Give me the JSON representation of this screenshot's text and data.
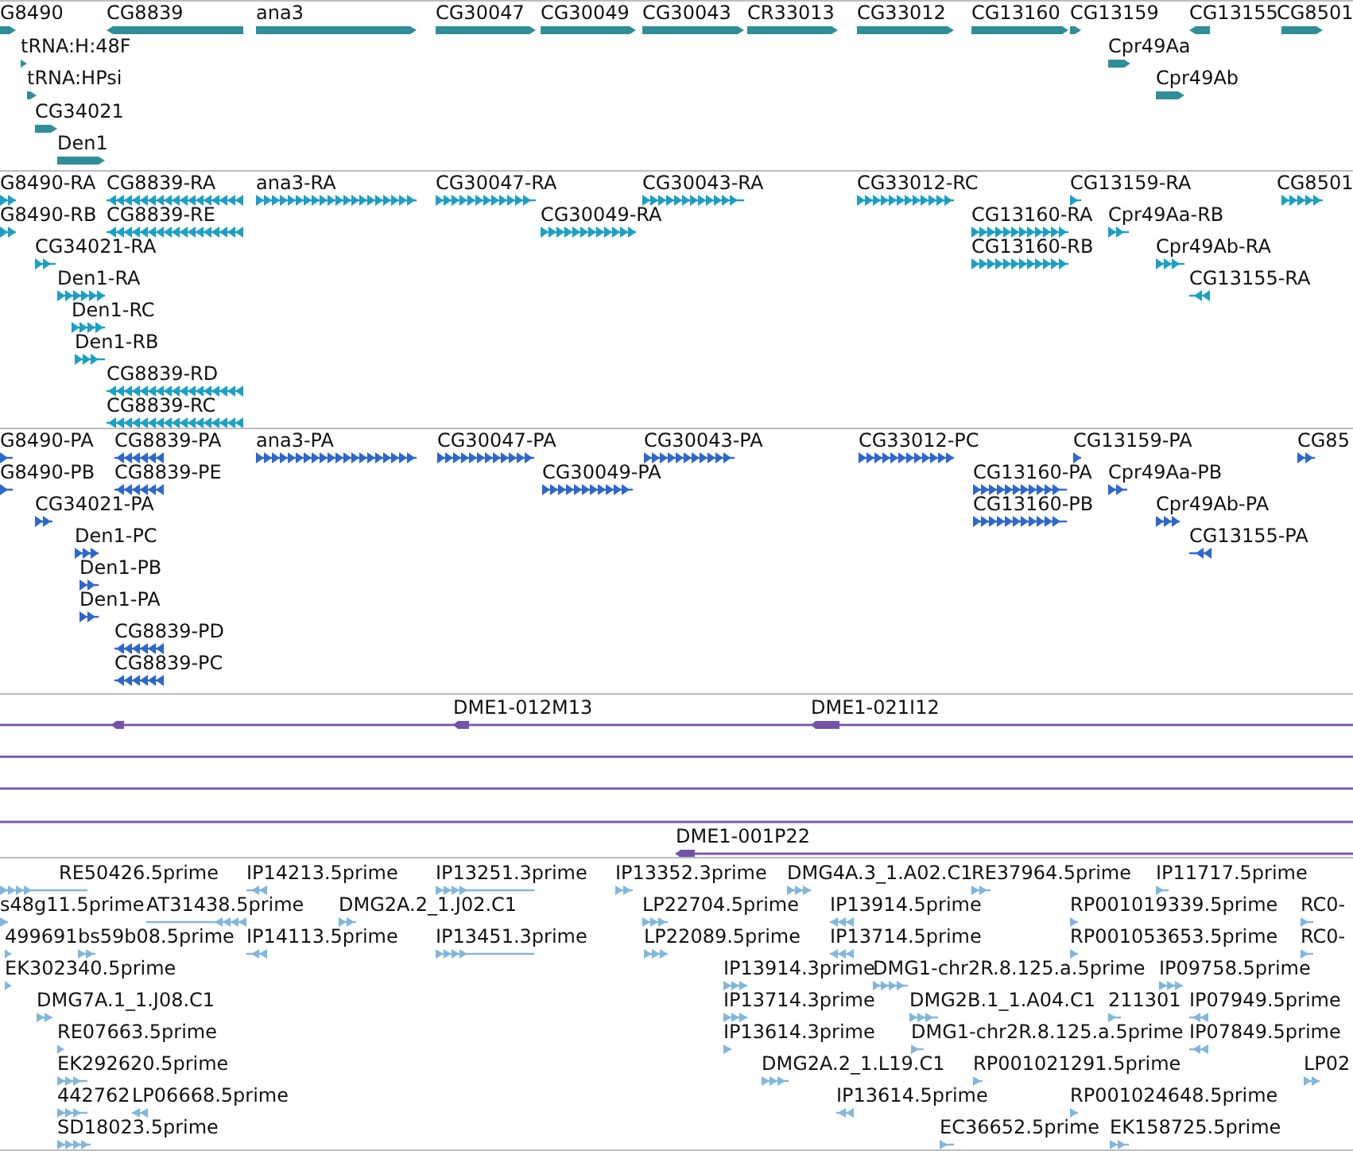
{
  "tracks": [
    {
      "kind": "gene",
      "color": "#2f8e97",
      "lanes": [
        {
          "features": [
            {
              "label": "G8490",
              "reverse": false
            },
            {
              "label": "CG8839",
              "reverse": true
            },
            {
              "label": "ana3",
              "reverse": false
            },
            {
              "label": "CG30047",
              "reverse": false
            },
            {
              "label": "CG30049",
              "reverse": false
            },
            {
              "label": "CG30043",
              "reverse": false
            },
            {
              "label": "CR33013",
              "reverse": false
            },
            {
              "label": "CG33012",
              "reverse": false
            },
            {
              "label": "CG13160",
              "reverse": false
            },
            {
              "label": "CG13159",
              "reverse": false
            },
            {
              "label": "CG13155",
              "reverse": true
            },
            {
              "label": "CG8501",
              "reverse": false
            }
          ]
        },
        {
          "features": [
            {
              "label": "tRNA:H:48F",
              "reverse": false
            },
            {
              "label": "Cpr49Aa",
              "reverse": false
            }
          ]
        },
        {
          "features": [
            {
              "label": "tRNA:HPsi",
              "reverse": false
            },
            {
              "label": "Cpr49Ab",
              "reverse": false
            }
          ]
        },
        {
          "features": [
            {
              "label": "CG34021",
              "reverse": false
            }
          ]
        },
        {
          "features": [
            {
              "label": "Den1",
              "reverse": false
            }
          ]
        }
      ]
    },
    {
      "kind": "transcript",
      "color": "#1b9fc6",
      "lanes": [
        {
          "features": [
            {
              "label": "G8490-RA",
              "reverse": false
            },
            {
              "label": "CG8839-RA",
              "reverse": true
            },
            {
              "label": "ana3-RA",
              "reverse": false
            },
            {
              "label": "CG30047-RA",
              "reverse": false
            },
            {
              "label": "CG30043-RA",
              "reverse": false
            },
            {
              "label": "CG33012-RC",
              "reverse": false
            },
            {
              "label": "CG13159-RA",
              "reverse": false
            },
            {
              "label": "CG8501",
              "reverse": false
            }
          ]
        },
        {
          "features": [
            {
              "label": "G8490-RB",
              "reverse": false
            },
            {
              "label": "CG8839-RE",
              "reverse": true
            },
            {
              "label": "CG30049-RA",
              "reverse": false
            },
            {
              "label": "CG13160-RA",
              "reverse": false
            },
            {
              "label": "Cpr49Aa-RB",
              "reverse": false
            }
          ]
        },
        {
          "features": [
            {
              "label": "CG34021-RA",
              "reverse": false
            },
            {
              "label": "CG13160-RB",
              "reverse": false
            },
            {
              "label": "Cpr49Ab-RA",
              "reverse": false
            }
          ]
        },
        {
          "features": [
            {
              "label": "Den1-RA",
              "reverse": false
            },
            {
              "label": "CG13155-RA",
              "reverse": true
            }
          ]
        },
        {
          "features": [
            {
              "label": "Den1-RC",
              "reverse": false
            }
          ]
        },
        {
          "features": [
            {
              "label": "Den1-RB",
              "reverse": false
            }
          ]
        },
        {
          "features": [
            {
              "label": "CG8839-RD",
              "reverse": true
            }
          ]
        },
        {
          "features": [
            {
              "label": "CG8839-RC",
              "reverse": true
            }
          ]
        }
      ]
    },
    {
      "kind": "transcript",
      "color": "#2c66cf",
      "lanes": [
        {
          "features": [
            {
              "label": "G8490-PA",
              "reverse": false
            },
            {
              "label": "CG8839-PA",
              "reverse": true
            },
            {
              "label": "ana3-PA",
              "reverse": false
            },
            {
              "label": "CG30047-PA",
              "reverse": false
            },
            {
              "label": "CG30043-PA",
              "reverse": false
            },
            {
              "label": "CG33012-PC",
              "reverse": false
            },
            {
              "label": "CG13159-PA",
              "reverse": false
            },
            {
              "label": "CG85",
              "reverse": false
            }
          ]
        },
        {
          "features": [
            {
              "label": "G8490-PB",
              "reverse": false
            },
            {
              "label": "CG8839-PE",
              "reverse": true
            },
            {
              "label": "CG30049-PA",
              "reverse": false
            },
            {
              "label": "CG13160-PA",
              "reverse": false
            },
            {
              "label": "Cpr49Aa-PB",
              "reverse": false
            }
          ]
        },
        {
          "features": [
            {
              "label": "CG34021-PA",
              "reverse": false
            },
            {
              "label": "CG13160-PB",
              "reverse": false
            },
            {
              "label": "Cpr49Ab-PA",
              "reverse": false
            }
          ]
        },
        {
          "features": [
            {
              "label": "Den1-PC",
              "reverse": false
            },
            {
              "label": "CG13155-PA",
              "reverse": true
            }
          ]
        },
        {
          "features": [
            {
              "label": "Den1-PB",
              "reverse": false
            }
          ]
        },
        {
          "features": [
            {
              "label": "Den1-PA",
              "reverse": false
            }
          ]
        },
        {
          "features": [
            {
              "label": "CG8839-PD",
              "reverse": true
            }
          ]
        },
        {
          "features": [
            {
              "label": "CG8839-PC",
              "reverse": true
            }
          ]
        }
      ]
    },
    {
      "kind": "clone",
      "color": "#7454aa",
      "lanes": [
        {
          "features": [
            {
              "kind": "clone"
            },
            {
              "kind": "clone",
              "label": "DME1-012M13"
            },
            {
              "kind": "clone",
              "label": "DME1-021I12"
            }
          ]
        },
        {
          "features": [
            {
              "kind": "span"
            }
          ]
        },
        {
          "features": [
            {
              "kind": "span"
            }
          ]
        },
        {
          "features": [
            {
              "kind": "span"
            }
          ]
        },
        {
          "features": [
            {
              "kind": "clone",
              "label": "DME1-001P22"
            }
          ]
        }
      ]
    },
    {
      "kind": "est",
      "color": "#80b6de",
      "lanes": [
        {
          "features": [
            {
              "label": "RE50426.5prime",
              "reverse": false
            },
            {
              "label": "IP14213.5prime",
              "reverse": true
            },
            {
              "label": "IP13251.3prime",
              "reverse": false
            },
            {
              "label": "IP13352.3prime",
              "reverse": false
            },
            {
              "label": "DMG4A.3_1.A02.C1",
              "reverse": false
            },
            {
              "label": "RE37964.5prime",
              "reverse": false
            },
            {
              "label": "IP11717.5prime",
              "reverse": false
            }
          ]
        },
        {
          "features": [
            {
              "label": "s48g11.5prime",
              "reverse": false
            },
            {
              "label": "AT31438.5prime",
              "reverse": true
            },
            {
              "label": "DMG2A.2_1.J02.C1",
              "reverse": false
            },
            {
              "label": "LP22704.5prime",
              "reverse": false
            },
            {
              "label": "IP13914.5prime",
              "reverse": true
            },
            {
              "label": "RP001019339.5prime",
              "reverse": false
            },
            {
              "label": "RC0-",
              "reverse": false
            }
          ]
        },
        {
          "features": [
            {
              "label": "499691",
              "reverse": false
            },
            {
              "label": "bs59b08.5prime",
              "reverse": false
            },
            {
              "label": "IP14113.5prime",
              "reverse": true
            },
            {
              "label": "IP13451.3prime",
              "reverse": false
            },
            {
              "label": "LP22089.5prime",
              "reverse": false
            },
            {
              "label": "IP13714.5prime",
              "reverse": true
            },
            {
              "label": "RP001053653.5prime",
              "reverse": false
            },
            {
              "label": "RC0-",
              "reverse": false
            }
          ]
        },
        {
          "features": [
            {
              "label": "EK302340.5prime",
              "reverse": false
            },
            {
              "label": "IP13914.3prime",
              "reverse": false
            },
            {
              "label": "DMG1-chr2R.8.125.a.5prime",
              "reverse": false
            },
            {
              "label": "IP09758.5prime",
              "reverse": false
            }
          ]
        },
        {
          "features": [
            {
              "label": "DMG7A.1_1.J08.C1",
              "reverse": false
            },
            {
              "label": "IP13714.3prime",
              "reverse": false
            },
            {
              "label": "DMG2B.1_1.A04.C1",
              "reverse": false
            },
            {
              "label": "211301",
              "reverse": false
            },
            {
              "label": "IP07949.5prime",
              "reverse": true
            }
          ]
        },
        {
          "features": [
            {
              "label": "RE07663.5prime",
              "reverse": false
            },
            {
              "label": "IP13614.3prime",
              "reverse": false
            },
            {
              "label": "DMG1-chr2R.8.125.a.5prime",
              "reverse": false
            },
            {
              "label": "IP07849.5prime",
              "reverse": true
            }
          ]
        },
        {
          "features": [
            {
              "label": "EK292620.5prime",
              "reverse": false
            },
            {
              "label": "DMG2A.2_1.L19.C1",
              "reverse": false
            },
            {
              "label": "RP001021291.5prime",
              "reverse": false
            },
            {
              "label": "LP02",
              "reverse": false
            }
          ]
        },
        {
          "features": [
            {
              "label": "442762",
              "reverse": false
            },
            {
              "label": "LP06668.5prime",
              "reverse": true
            },
            {
              "label": "IP13614.5prime",
              "reverse": true
            },
            {
              "label": "RP001024648.5prime",
              "reverse": false
            }
          ]
        },
        {
          "features": [
            {
              "label": "SD18023.5prime",
              "reverse": false
            },
            {
              "label": "EC36652.5prime",
              "reverse": false
            },
            {
              "label": "EK158725.5prime",
              "reverse": false
            }
          ]
        }
      ]
    }
  ]
}
